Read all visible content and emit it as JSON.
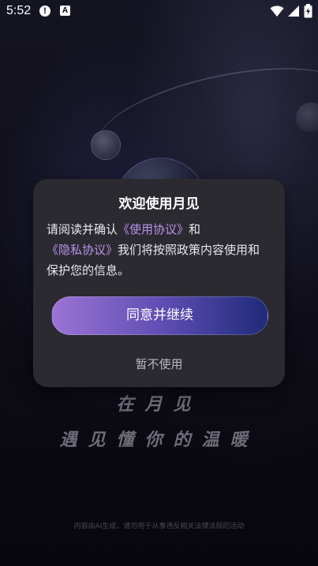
{
  "status_bar": {
    "time": "5:52",
    "alert_icon_text": "!",
    "a_icon_text": "A",
    "icons": [
      "alert-icon",
      "a-icon",
      "wifi-icon",
      "signal-icon",
      "battery-icon"
    ]
  },
  "dialog": {
    "title": "欢迎使用月见",
    "body_prefix": "请阅读并确认",
    "link_terms": "《使用协议》",
    "body_and": "和",
    "link_privacy": "《隐私协议》",
    "body_suffix": "我们将按照政策内容使用和保护您的信息。",
    "agree_label": "同意并继续",
    "decline_label": "暂不使用"
  },
  "slogan": {
    "line1": "在月见",
    "line2": "遇见懂你的温暖"
  },
  "footer_note": "内容由AI生成，请勿用于从事违反相关法律法规的活动",
  "colors": {
    "link": "#b894ea",
    "dialog_bg": "#2b2a31",
    "button_gradient_start": "#9b74d6",
    "button_gradient_end": "#1f2a78"
  }
}
